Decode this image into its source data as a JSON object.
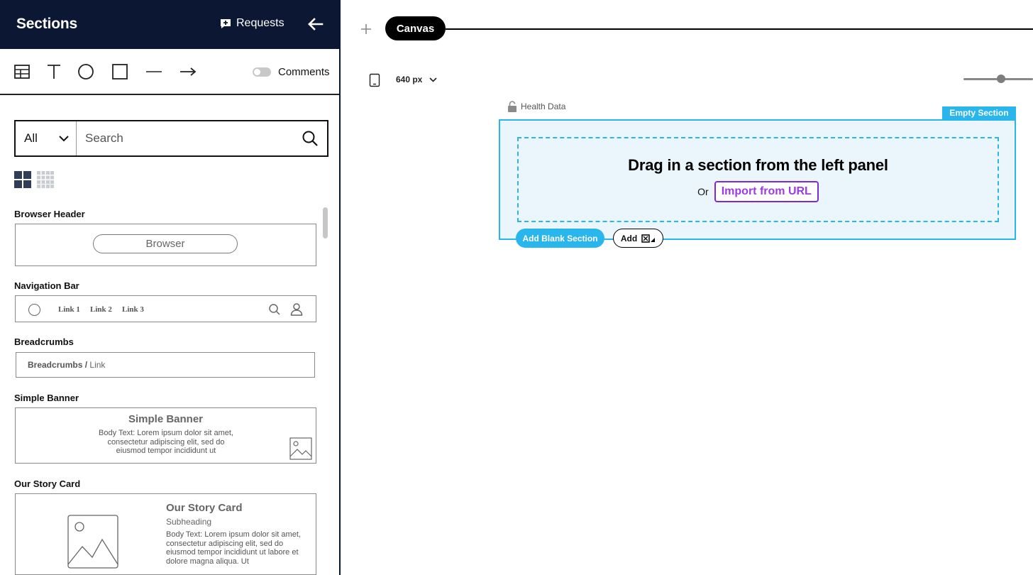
{
  "panel": {
    "title": "Sections",
    "requests_label": "Requests",
    "tools": [
      "table-icon",
      "text-icon",
      "circle-icon",
      "rectangle-icon",
      "line-icon",
      "arrow-icon"
    ],
    "comments_label": "Comments",
    "comments_enabled": false
  },
  "search": {
    "filter_value": "All",
    "placeholder": "Search",
    "value": ""
  },
  "sections": [
    {
      "label": "Browser Header",
      "preview": {
        "pill_text": "Browser"
      }
    },
    {
      "label": "Navigation Bar",
      "preview": {
        "links": [
          "Link 1",
          "Link 2",
          "Link 3"
        ]
      }
    },
    {
      "label": "Breadcrumbs",
      "preview": {
        "crumb": "Breadcrumbs",
        "separator": "/",
        "link": "Link"
      }
    },
    {
      "label": "Simple Banner",
      "preview": {
        "title": "Simple Banner",
        "body": "Body Text: Lorem ipsum dolor sit amet, consectetur adipiscing elit, sed do eiusmod tempor incididunt ut"
      }
    },
    {
      "label": "Our Story Card",
      "preview": {
        "title": "Our Story Card",
        "subheading": "Subheading",
        "body": "Body Text: Lorem ipsum dolor sit amet, consectetur adipiscing elit, sed do eiusmod tempor incididunt ut labore et dolore magna aliqua. Ut"
      }
    }
  ],
  "canvas": {
    "tab_label": "Canvas",
    "width_value": "640 px",
    "section_name": "Health Data",
    "badge": "Empty Section",
    "drop_title": "Drag in a section from the left panel",
    "or_text": "Or",
    "import_label": "Import from URL",
    "add_blank_label": "Add Blank Section",
    "add_label": "Add"
  },
  "colors": {
    "header_bg": "#0b1733",
    "accent_blue": "#29b6ec",
    "import_purple": "#9b3be6"
  }
}
